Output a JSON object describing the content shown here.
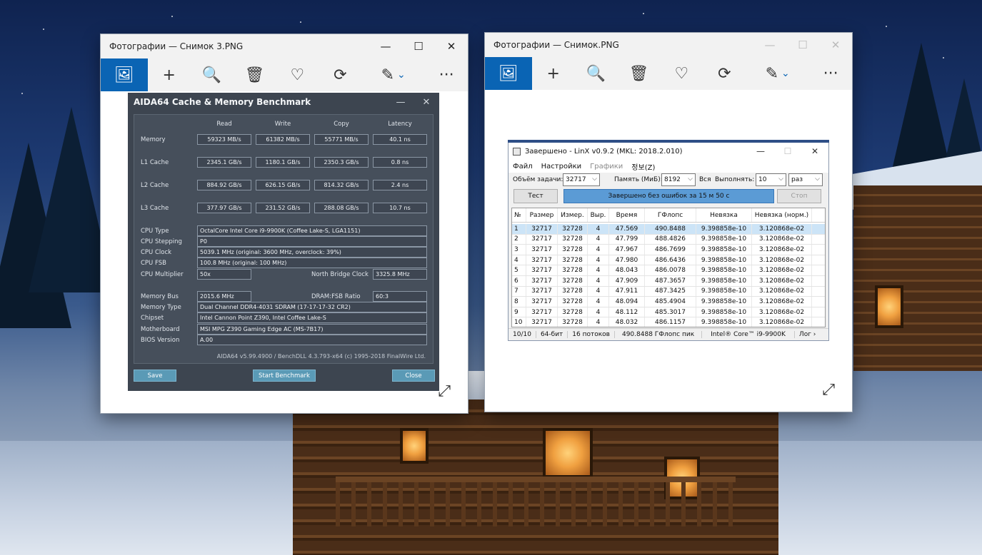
{
  "window1": {
    "title": "Фотографии — Снимок 3.PNG",
    "controls": {
      "minimize": "—",
      "maximize": "☐",
      "close": "✕"
    },
    "tools": {
      "image": "🖼",
      "add": "+",
      "zoom": "🔍",
      "delete": "🗑",
      "favorite": "♡",
      "rotate": "⟳",
      "edit": "✎",
      "edit_arrow": "⌄",
      "more": "···"
    }
  },
  "window2": {
    "title": "Фотографии — Снимок.PNG",
    "controls": {
      "minimize": "—",
      "maximize": "☐",
      "close": "✕"
    },
    "tools": {
      "image": "🖼",
      "add": "+",
      "zoom": "🔍",
      "delete": "🗑",
      "favorite": "♡",
      "rotate": "⟳",
      "edit": "✎",
      "edit_arrow": "⌄",
      "more": "···"
    }
  },
  "expand_glyph": "⤢",
  "aida": {
    "title": "AIDA64 Cache & Memory Benchmark",
    "ctl_min": "—",
    "ctl_close": "✕",
    "headers": [
      "Read",
      "Write",
      "Copy",
      "Latency"
    ],
    "rows": [
      {
        "label": "Memory",
        "values": [
          "59323 MB/s",
          "61382 MB/s",
          "55771 MB/s",
          "40.1 ns"
        ]
      },
      {
        "label": "L1 Cache",
        "values": [
          "2345.1 GB/s",
          "1180.1 GB/s",
          "2350.3 GB/s",
          "0.8 ns"
        ]
      },
      {
        "label": "L2 Cache",
        "values": [
          "884.92 GB/s",
          "626.15 GB/s",
          "814.32 GB/s",
          "2.4 ns"
        ]
      },
      {
        "label": "L3 Cache",
        "values": [
          "377.97 GB/s",
          "231.52 GB/s",
          "288.08 GB/s",
          "10.7 ns"
        ]
      }
    ],
    "cpu_type_label": "CPU Type",
    "cpu_type": "OctalCore Intel Core i9-9900K  (Coffee Lake-S, LGA1151)",
    "cpu_stepping_label": "CPU Stepping",
    "cpu_stepping": "P0",
    "cpu_clock_label": "CPU Clock",
    "cpu_clock": "5039.1 MHz  (original: 3600 MHz, overclock: 39%)",
    "cpu_fsb_label": "CPU FSB",
    "cpu_fsb": "100.8 MHz  (original: 100 MHz)",
    "cpu_mult_label": "CPU Multiplier",
    "cpu_mult": "50x",
    "nb_clock_label": "North Bridge Clock",
    "nb_clock": "3325.8 MHz",
    "mem_bus_label": "Memory Bus",
    "mem_bus": "2015.6 MHz",
    "dram_ratio_label": "DRAM:FSB Ratio",
    "dram_ratio": "60:3",
    "mem_type_label": "Memory Type",
    "mem_type": "Dual Channel DDR4-4031 SDRAM  (17-17-17-32 CR2)",
    "chipset_label": "Chipset",
    "chipset": "Intel Cannon Point Z390, Intel Coffee Lake-S",
    "motherboard_label": "Motherboard",
    "motherboard": "MSI MPG Z390 Gaming Edge AC (MS-7B17)",
    "bios_label": "BIOS Version",
    "bios": "A.00",
    "footer": "AIDA64 v5.99.4900 / BenchDLL 4.3.793-x64  (c) 1995-2018 FinalWire Ltd.",
    "save_btn": "Save",
    "start_btn": "Start Benchmark",
    "close_btn": "Close"
  },
  "linx": {
    "title": "Завершено - LinX v0.9.2 (MKL: 2018.2.010)",
    "ctl_min": "—",
    "ctl_max": "☐",
    "ctl_close": "✕",
    "menu": [
      "Файл",
      "Настройки",
      "Графики",
      "정보(Z)"
    ],
    "task_label": "Объём задачи:",
    "task_value": "32717",
    "mem_label": "Память (МиБ):",
    "mem_value": "8192",
    "all_label": "Вся",
    "run_label": "Выполнять:",
    "run_value": "10",
    "unit_value": "раз",
    "arrow": "⌵",
    "test_btn": "Тест",
    "progress_text": "Завершено без ошибок за 15 м 50 с",
    "stop_btn": "Стоп",
    "columns": [
      "№",
      "Размер",
      "Измер.",
      "Выр.",
      "Время",
      "ГФлопс",
      "Невязка",
      "Невязка (норм.)"
    ],
    "rows": [
      [
        "1",
        "32717",
        "32728",
        "4",
        "47.569",
        "490.8488",
        "9.398858e-10",
        "3.120868e-02"
      ],
      [
        "2",
        "32717",
        "32728",
        "4",
        "47.799",
        "488.4826",
        "9.398858e-10",
        "3.120868e-02"
      ],
      [
        "3",
        "32717",
        "32728",
        "4",
        "47.967",
        "486.7699",
        "9.398858e-10",
        "3.120868e-02"
      ],
      [
        "4",
        "32717",
        "32728",
        "4",
        "47.980",
        "486.6436",
        "9.398858e-10",
        "3.120868e-02"
      ],
      [
        "5",
        "32717",
        "32728",
        "4",
        "48.043",
        "486.0078",
        "9.398858e-10",
        "3.120868e-02"
      ],
      [
        "6",
        "32717",
        "32728",
        "4",
        "47.909",
        "487.3657",
        "9.398858e-10",
        "3.120868e-02"
      ],
      [
        "7",
        "32717",
        "32728",
        "4",
        "47.911",
        "487.3425",
        "9.398858e-10",
        "3.120868e-02"
      ],
      [
        "8",
        "32717",
        "32728",
        "4",
        "48.094",
        "485.4904",
        "9.398858e-10",
        "3.120868e-02"
      ],
      [
        "9",
        "32717",
        "32728",
        "4",
        "48.112",
        "485.3017",
        "9.398858e-10",
        "3.120868e-02"
      ],
      [
        "10",
        "32717",
        "32728",
        "4",
        "48.032",
        "486.1157",
        "9.398858e-10",
        "3.120868e-02"
      ]
    ],
    "status": [
      "10/10",
      "64-бит",
      "16 потоков",
      "490.8488 ГФлопс пик",
      "Intel® Core™ i9-9900K",
      "Лог ›"
    ]
  },
  "colors": {
    "accent": "#0a64b4",
    "aida_bg": "#3d4550",
    "aida_button": "#5a9ab6",
    "linx_progress": "#5b9bd5"
  }
}
